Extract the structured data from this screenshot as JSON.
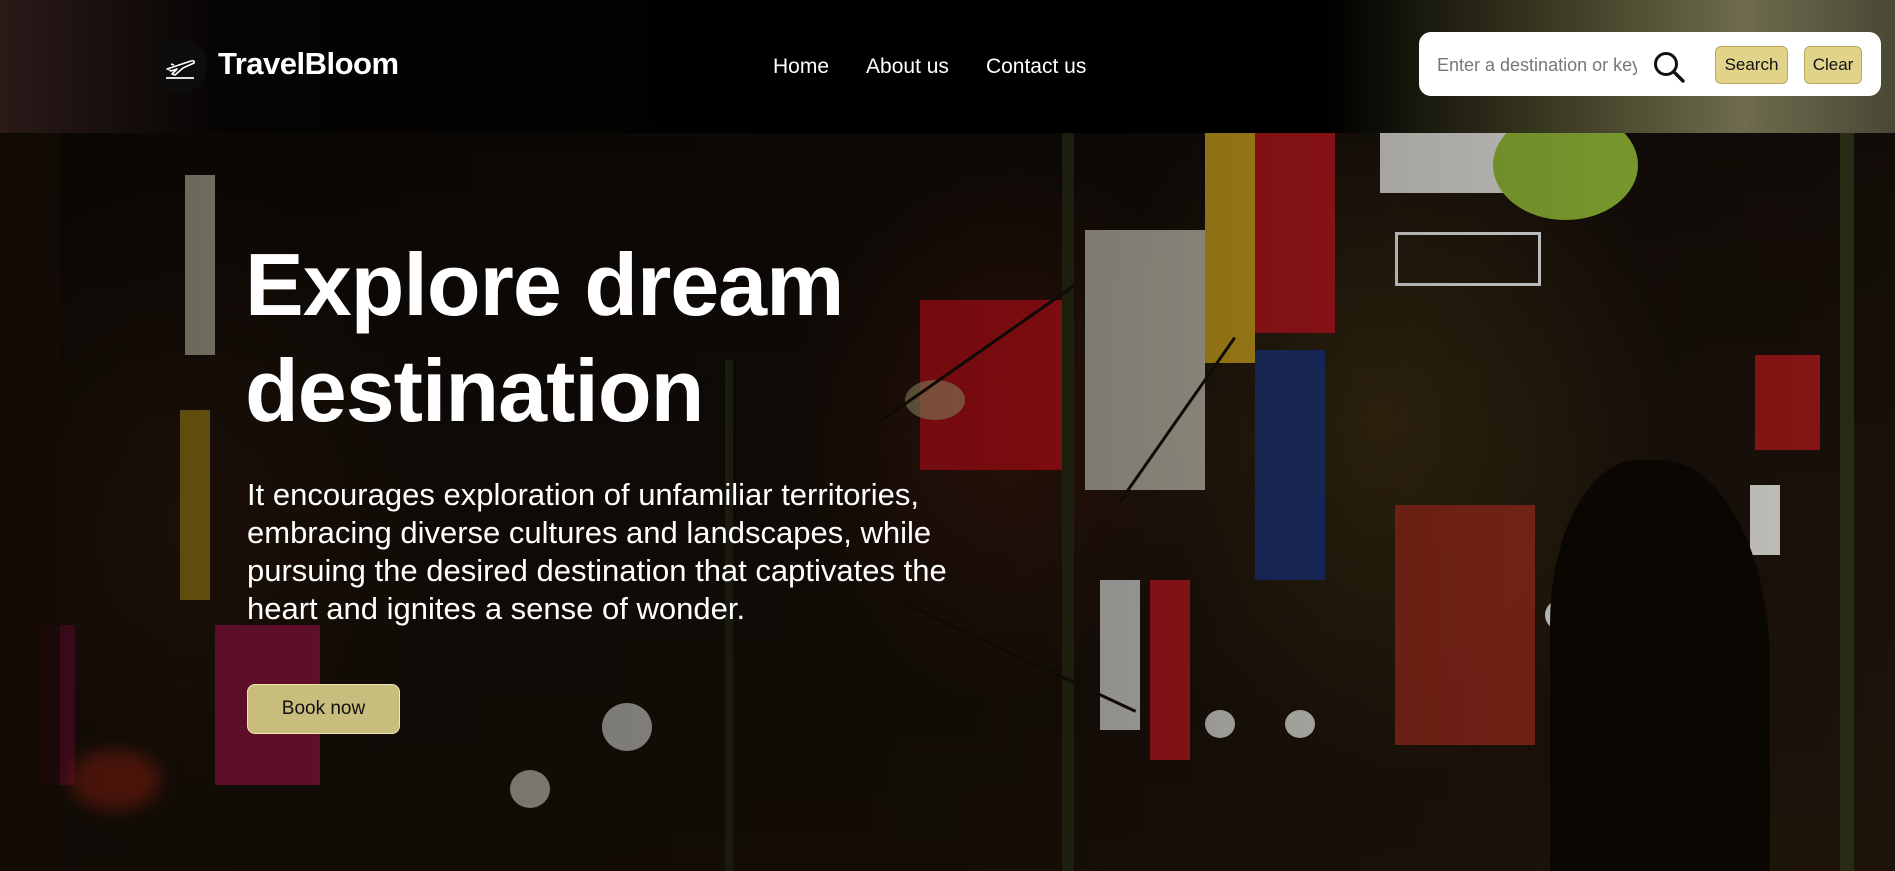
{
  "brand": {
    "name": "TravelBloom",
    "icon": "airplane-departure-icon"
  },
  "nav": {
    "items": [
      {
        "label": "Home"
      },
      {
        "label": "About us"
      },
      {
        "label": "Contact us"
      }
    ]
  },
  "search": {
    "placeholder": "Enter a destination or keyword",
    "value": "",
    "search_label": "Search",
    "clear_label": "Clear",
    "icon": "search-icon"
  },
  "hero": {
    "title_line1": "Explore dream",
    "title_line2": "destination",
    "description": "It encourages exploration of unfamiliar territories, embracing diverse cultures and landscapes, while pursuing the desired destination that captivates the heart and ignites a sense of wonder.",
    "cta_label": "Book now"
  },
  "colors": {
    "accent": "#e2d38a",
    "cta": "#c8bd7d",
    "header": "#000000",
    "text": "#ffffff"
  }
}
